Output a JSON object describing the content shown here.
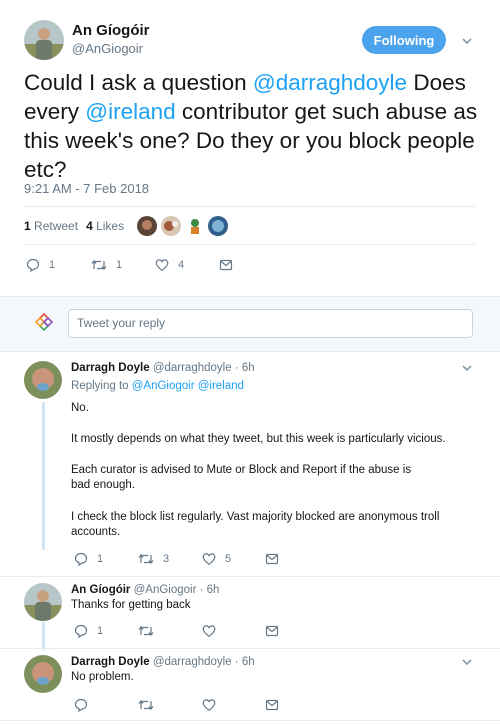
{
  "main": {
    "name": "An Gíogóir",
    "handle": "@AnGiogoir",
    "follow_label": "Following",
    "text_parts": [
      "Could I ask a question ",
      "@darraghdoyle",
      " Does every ",
      "@ireland",
      " contributor get such abuse as this week's one? Do they or you block people etc?"
    ],
    "timestamp": "9:21 AM - 7 Feb 2018",
    "retweets_count": "1",
    "retweets_label": "Retweet",
    "likes_count": "4",
    "likes_label": "Likes",
    "reply_count": "1",
    "retweet_count": "1",
    "like_count": "4"
  },
  "reply_box": {
    "placeholder": "Tweet your reply"
  },
  "replies": [
    {
      "name": "Darragh Doyle",
      "meta": "@darraghdoyle · 6h",
      "replying_prefix": "Replying to ",
      "replying_users": "@AnGiogoir @ireland",
      "paragraphs": [
        "No.",
        "It mostly depends on what they tweet, but this week is particularly vicious.",
        "Each curator is advised to Mute or Block and Report if the abuse is bad enough.",
        "I check the block list regularly. Vast majority blocked are anonymous troll accounts."
      ],
      "reply_count": "1",
      "retweet_count": "3",
      "like_count": "5"
    },
    {
      "name": "An Gíogóir",
      "meta": "@AnGiogoir · 6h",
      "paragraphs": [
        "Thanks for getting back"
      ],
      "reply_count": "1",
      "retweet_count": "",
      "like_count": ""
    },
    {
      "name": "Darragh Doyle",
      "meta": "@darraghdoyle · 6h",
      "paragraphs": [
        "No problem."
      ],
      "reply_count": "",
      "retweet_count": "",
      "like_count": ""
    }
  ],
  "colors": {
    "accent": "#1da1f2",
    "follow_button": "#4ba3eb",
    "muted": "#657786",
    "thread_line": "#cfe6f8"
  },
  "icons": [
    "reply-icon",
    "retweet-icon",
    "like-icon",
    "message-icon",
    "chevron-down-icon"
  ]
}
